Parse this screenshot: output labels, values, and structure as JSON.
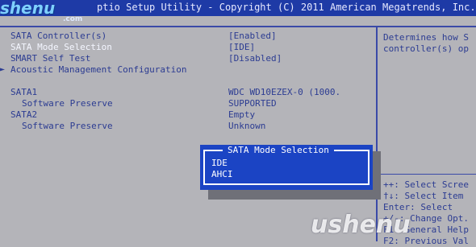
{
  "window": {
    "title": "ptio Setup Utility - Copyright (C) 2011 American Megatrends, Inc."
  },
  "watermark": {
    "logo_text": "shenu",
    "logo_suffix": ".com",
    "bottom_text": "ushenu"
  },
  "settings": [
    {
      "label": "SATA Controller(s)",
      "value": "[Enabled]"
    },
    {
      "label": "SATA Mode Selection",
      "value": "[IDE]"
    },
    {
      "label": "SMART Self Test",
      "value": "[Disabled]"
    },
    {
      "label": "Acoustic Management Configuration",
      "value": ""
    }
  ],
  "drives": [
    {
      "name": "SATA1",
      "model": "WDC WD10EZEX-0 (1000.",
      "preserve_label": "Software Preserve",
      "preserve_value": "SUPPORTED"
    },
    {
      "name": "SATA2",
      "model": "Empty",
      "preserve_label": "Software Preserve",
      "preserve_value": "Unknown"
    }
  ],
  "help": {
    "line1": "Determines how S",
    "line2": "controller(s) op"
  },
  "keys": [
    "++: Select Scree",
    "†↓: Select Item",
    "Enter: Select",
    "+/-: Change Opt.",
    "F1: General Help",
    "F2: Previous Val"
  ],
  "popup": {
    "title": "SATA Mode Selection",
    "options": [
      "IDE",
      "AHCI"
    ]
  }
}
